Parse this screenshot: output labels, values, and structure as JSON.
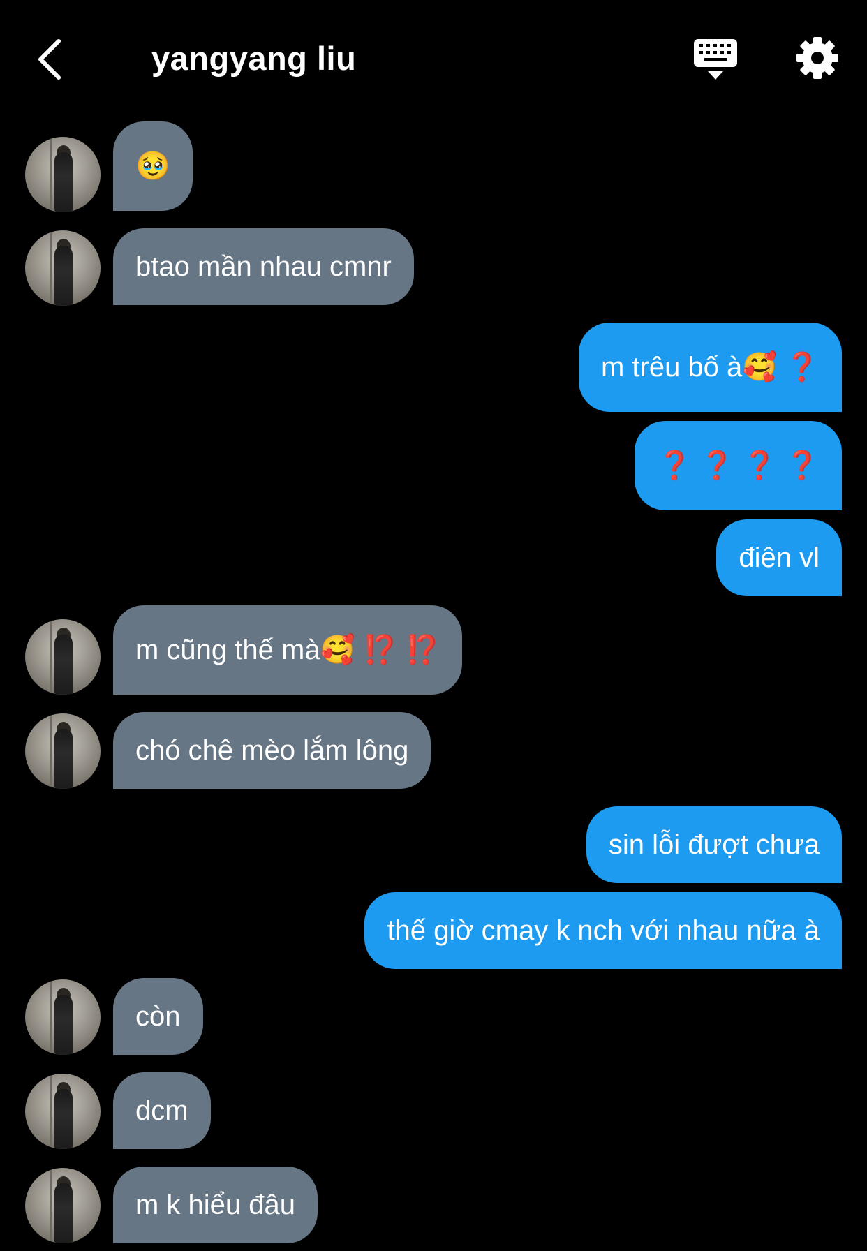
{
  "header": {
    "title": "yangyang liu"
  },
  "messages": [
    {
      "side": "in",
      "text": "🥹"
    },
    {
      "side": "in",
      "text": "btao mần nhau cmnr"
    },
    {
      "side": "out",
      "text": "m trêu bố à🥰 ❓"
    },
    {
      "side": "out",
      "text": "❓ ❓ ❓ ❓"
    },
    {
      "side": "out",
      "text": "điên vl"
    },
    {
      "side": "in",
      "text": "m cũng thế mà🥰 ⁉️ ⁉️"
    },
    {
      "side": "in",
      "text": "chó chê mèo lắm lông"
    },
    {
      "side": "out",
      "text": "sin lỗi đượt chưa"
    },
    {
      "side": "out",
      "text": "thế giờ cmay k nch với nhau nữa à"
    },
    {
      "side": "in",
      "text": "còn"
    },
    {
      "side": "in",
      "text": "dcm"
    },
    {
      "side": "in",
      "text": "m k hiểu đâu"
    }
  ],
  "colors": {
    "incoming_bubble": "#677684",
    "outgoing_bubble": "#1d9bf0",
    "background": "#000000"
  },
  "icons": [
    "back-chevron-icon",
    "keyboard-icon",
    "gear-icon"
  ]
}
